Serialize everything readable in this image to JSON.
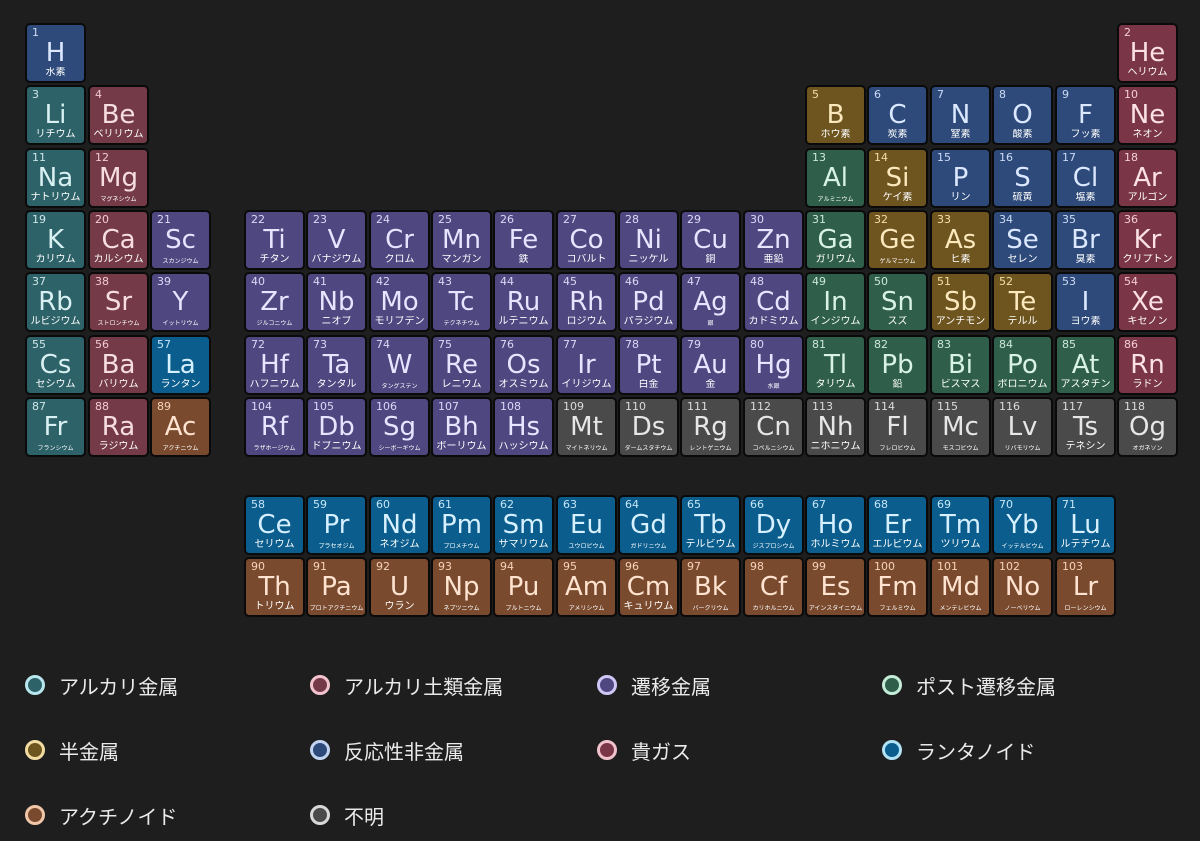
{
  "colors": {
    "alkali": {
      "bg": "#2d6269",
      "sym": "#d8f0f2",
      "num": "#cfe6e8",
      "dot": "#b8e6ee"
    },
    "alkaline": {
      "bg": "#743a48",
      "sym": "#f6dde2",
      "num": "#f2cad2",
      "dot": "#f3c4cf"
    },
    "transition": {
      "bg": "#4e4780",
      "sym": "#e8e4ff",
      "num": "#ddd8f6",
      "dot": "#cfc6f6"
    },
    "post": {
      "bg": "#2f5f4b",
      "sym": "#d8f2e6",
      "num": "#cce8da",
      "dot": "#c4ecd8"
    },
    "metalloid": {
      "bg": "#6e5520",
      "sym": "#fbe9bd",
      "num": "#f6dfa6",
      "dot": "#f2dca2"
    },
    "nonmetal": {
      "bg": "#2e4a7a",
      "sym": "#dbe8ff",
      "num": "#cddcf6",
      "dot": "#c2d4f2"
    },
    "noble": {
      "bg": "#7a3646",
      "sym": "#fbe0e6",
      "num": "#f4cdd6",
      "dot": "#f0c2cc"
    },
    "lanth": {
      "bg": "#0a5d8c",
      "sym": "#d6f0ff",
      "num": "#c6e6f8",
      "dot": "#b2e2f6"
    },
    "actin": {
      "bg": "#7a4a2e",
      "sym": "#fde3d0",
      "num": "#f6d3bb",
      "dot": "#f0c6a8"
    },
    "unknown": {
      "bg": "#4a4a4a",
      "sym": "#e6e6e6",
      "num": "#dcdcdc",
      "dot": "#d8d8d8"
    }
  },
  "elements": [
    {
      "n": "1",
      "s": "H",
      "jp": "水素",
      "c": "nonmetal",
      "col": 1,
      "row": 1
    },
    {
      "n": "2",
      "s": "He",
      "jp": "ヘリウム",
      "c": "noble",
      "col": 18,
      "row": 1
    },
    {
      "n": "3",
      "s": "Li",
      "jp": "リチウム",
      "c": "alkali",
      "col": 1,
      "row": 2
    },
    {
      "n": "4",
      "s": "Be",
      "jp": "ベリリウム",
      "c": "alkaline",
      "col": 2,
      "row": 2
    },
    {
      "n": "5",
      "s": "B",
      "jp": "ホウ素",
      "c": "metalloid",
      "col": 13,
      "row": 2
    },
    {
      "n": "6",
      "s": "C",
      "jp": "炭素",
      "c": "nonmetal",
      "col": 14,
      "row": 2
    },
    {
      "n": "7",
      "s": "N",
      "jp": "窒素",
      "c": "nonmetal",
      "col": 15,
      "row": 2
    },
    {
      "n": "8",
      "s": "O",
      "jp": "酸素",
      "c": "nonmetal",
      "col": 16,
      "row": 2
    },
    {
      "n": "9",
      "s": "F",
      "jp": "フッ素",
      "c": "nonmetal",
      "col": 17,
      "row": 2
    },
    {
      "n": "10",
      "s": "Ne",
      "jp": "ネオン",
      "c": "noble",
      "col": 18,
      "row": 2
    },
    {
      "n": "11",
      "s": "Na",
      "jp": "ナトリウム",
      "c": "alkali",
      "col": 1,
      "row": 3
    },
    {
      "n": "12",
      "s": "Mg",
      "jp": "マグネシウム",
      "c": "alkaline",
      "col": 2,
      "row": 3,
      "sz": "xs"
    },
    {
      "n": "13",
      "s": "Al",
      "jp": "アルミニウム",
      "c": "post",
      "col": 13,
      "row": 3,
      "sz": "xs"
    },
    {
      "n": "14",
      "s": "Si",
      "jp": "ケイ素",
      "c": "metalloid",
      "col": 14,
      "row": 3
    },
    {
      "n": "15",
      "s": "P",
      "jp": "リン",
      "c": "nonmetal",
      "col": 15,
      "row": 3
    },
    {
      "n": "16",
      "s": "S",
      "jp": "硫黄",
      "c": "nonmetal",
      "col": 16,
      "row": 3
    },
    {
      "n": "17",
      "s": "Cl",
      "jp": "塩素",
      "c": "nonmetal",
      "col": 17,
      "row": 3
    },
    {
      "n": "18",
      "s": "Ar",
      "jp": "アルゴン",
      "c": "noble",
      "col": 18,
      "row": 3
    },
    {
      "n": "19",
      "s": "K",
      "jp": "カリウム",
      "c": "alkali",
      "col": 1,
      "row": 4
    },
    {
      "n": "20",
      "s": "Ca",
      "jp": "カルシウム",
      "c": "alkaline",
      "col": 2,
      "row": 4
    },
    {
      "n": "21",
      "s": "Sc",
      "jp": "スカンジウム",
      "c": "transition",
      "col": 3,
      "row": 4,
      "sz": "xs"
    },
    {
      "n": "22",
      "s": "Ti",
      "jp": "チタン",
      "c": "transition",
      "col": 4,
      "row": 4
    },
    {
      "n": "23",
      "s": "V",
      "jp": "バナジウム",
      "c": "transition",
      "col": 5,
      "row": 4
    },
    {
      "n": "24",
      "s": "Cr",
      "jp": "クロム",
      "c": "transition",
      "col": 6,
      "row": 4
    },
    {
      "n": "25",
      "s": "Mn",
      "jp": "マンガン",
      "c": "transition",
      "col": 7,
      "row": 4
    },
    {
      "n": "26",
      "s": "Fe",
      "jp": "鉄",
      "c": "transition",
      "col": 8,
      "row": 4
    },
    {
      "n": "27",
      "s": "Co",
      "jp": "コバルト",
      "c": "transition",
      "col": 9,
      "row": 4
    },
    {
      "n": "28",
      "s": "Ni",
      "jp": "ニッケル",
      "c": "transition",
      "col": 10,
      "row": 4
    },
    {
      "n": "29",
      "s": "Cu",
      "jp": "銅",
      "c": "transition",
      "col": 11,
      "row": 4
    },
    {
      "n": "30",
      "s": "Zn",
      "jp": "亜鉛",
      "c": "transition",
      "col": 12,
      "row": 4
    },
    {
      "n": "31",
      "s": "Ga",
      "jp": "ガリウム",
      "c": "post",
      "col": 13,
      "row": 4
    },
    {
      "n": "32",
      "s": "Ge",
      "jp": "ゲルマニウム",
      "c": "metalloid",
      "col": 14,
      "row": 4,
      "sz": "xs"
    },
    {
      "n": "33",
      "s": "As",
      "jp": "ヒ素",
      "c": "metalloid",
      "col": 15,
      "row": 4
    },
    {
      "n": "34",
      "s": "Se",
      "jp": "セレン",
      "c": "nonmetal",
      "col": 16,
      "row": 4
    },
    {
      "n": "35",
      "s": "Br",
      "jp": "臭素",
      "c": "nonmetal",
      "col": 17,
      "row": 4
    },
    {
      "n": "36",
      "s": "Kr",
      "jp": "クリプトン",
      "c": "noble",
      "col": 18,
      "row": 4
    },
    {
      "n": "37",
      "s": "Rb",
      "jp": "ルビジウム",
      "c": "alkali",
      "col": 1,
      "row": 5
    },
    {
      "n": "38",
      "s": "Sr",
      "jp": "ストロンチウム",
      "c": "alkaline",
      "col": 2,
      "row": 5,
      "sz": "xs"
    },
    {
      "n": "39",
      "s": "Y",
      "jp": "イットリウム",
      "c": "transition",
      "col": 3,
      "row": 5,
      "sz": "xs"
    },
    {
      "n": "40",
      "s": "Zr",
      "jp": "ジルコニウム",
      "c": "transition",
      "col": 4,
      "row": 5,
      "sz": "xs"
    },
    {
      "n": "41",
      "s": "Nb",
      "jp": "ニオブ",
      "c": "transition",
      "col": 5,
      "row": 5
    },
    {
      "n": "42",
      "s": "Mo",
      "jp": "モリブデン",
      "c": "transition",
      "col": 6,
      "row": 5
    },
    {
      "n": "43",
      "s": "Tc",
      "jp": "テクネチウム",
      "c": "transition",
      "col": 7,
      "row": 5,
      "sz": "xs"
    },
    {
      "n": "44",
      "s": "Ru",
      "jp": "ルテニウム",
      "c": "transition",
      "col": 8,
      "row": 5
    },
    {
      "n": "45",
      "s": "Rh",
      "jp": "ロジウム",
      "c": "transition",
      "col": 9,
      "row": 5
    },
    {
      "n": "46",
      "s": "Pd",
      "jp": "パラジウム",
      "c": "transition",
      "col": 10,
      "row": 5
    },
    {
      "n": "47",
      "s": "Ag",
      "jp": "銀",
      "c": "transition",
      "col": 11,
      "row": 5,
      "sz": "xs"
    },
    {
      "n": "48",
      "s": "Cd",
      "jp": "カドミウム",
      "c": "transition",
      "col": 12,
      "row": 5
    },
    {
      "n": "49",
      "s": "In",
      "jp": "インジウム",
      "c": "post",
      "col": 13,
      "row": 5
    },
    {
      "n": "50",
      "s": "Sn",
      "jp": "スズ",
      "c": "post",
      "col": 14,
      "row": 5
    },
    {
      "n": "51",
      "s": "Sb",
      "jp": "アンチモン",
      "c": "metalloid",
      "col": 15,
      "row": 5
    },
    {
      "n": "52",
      "s": "Te",
      "jp": "テルル",
      "c": "metalloid",
      "col": 16,
      "row": 5
    },
    {
      "n": "53",
      "s": "I",
      "jp": "ヨウ素",
      "c": "nonmetal",
      "col": 17,
      "row": 5
    },
    {
      "n": "54",
      "s": "Xe",
      "jp": "キセノン",
      "c": "noble",
      "col": 18,
      "row": 5
    },
    {
      "n": "55",
      "s": "Cs",
      "jp": "セシウム",
      "c": "alkali",
      "col": 1,
      "row": 6
    },
    {
      "n": "56",
      "s": "Ba",
      "jp": "バリウム",
      "c": "alkaline",
      "col": 2,
      "row": 6
    },
    {
      "n": "57",
      "s": "La",
      "jp": "ランタン",
      "c": "lanth",
      "col": 3,
      "row": 6
    },
    {
      "n": "72",
      "s": "Hf",
      "jp": "ハフニウム",
      "c": "transition",
      "col": 4,
      "row": 6
    },
    {
      "n": "73",
      "s": "Ta",
      "jp": "タンタル",
      "c": "transition",
      "col": 5,
      "row": 6
    },
    {
      "n": "74",
      "s": "W",
      "jp": "タングステン",
      "c": "transition",
      "col": 6,
      "row": 6,
      "sz": "xs"
    },
    {
      "n": "75",
      "s": "Re",
      "jp": "レニウム",
      "c": "transition",
      "col": 7,
      "row": 6
    },
    {
      "n": "76",
      "s": "Os",
      "jp": "オスミウム",
      "c": "transition",
      "col": 8,
      "row": 6
    },
    {
      "n": "77",
      "s": "Ir",
      "jp": "イリジウム",
      "c": "transition",
      "col": 9,
      "row": 6
    },
    {
      "n": "78",
      "s": "Pt",
      "jp": "白金",
      "c": "transition",
      "col": 10,
      "row": 6
    },
    {
      "n": "79",
      "s": "Au",
      "jp": "金",
      "c": "transition",
      "col": 11,
      "row": 6
    },
    {
      "n": "80",
      "s": "Hg",
      "jp": "水銀",
      "c": "transition",
      "col": 12,
      "row": 6,
      "sz": "xs"
    },
    {
      "n": "81",
      "s": "Tl",
      "jp": "タリウム",
      "c": "post",
      "col": 13,
      "row": 6
    },
    {
      "n": "82",
      "s": "Pb",
      "jp": "鉛",
      "c": "post",
      "col": 14,
      "row": 6
    },
    {
      "n": "83",
      "s": "Bi",
      "jp": "ビスマス",
      "c": "post",
      "col": 15,
      "row": 6
    },
    {
      "n": "84",
      "s": "Po",
      "jp": "ポロニウム",
      "c": "post",
      "col": 16,
      "row": 6
    },
    {
      "n": "85",
      "s": "At",
      "jp": "アスタチン",
      "c": "post",
      "col": 17,
      "row": 6
    },
    {
      "n": "86",
      "s": "Rn",
      "jp": "ラドン",
      "c": "noble",
      "col": 18,
      "row": 6
    },
    {
      "n": "87",
      "s": "Fr",
      "jp": "フランシウム",
      "c": "alkali",
      "col": 1,
      "row": 7,
      "sz": "xs"
    },
    {
      "n": "88",
      "s": "Ra",
      "jp": "ラジウム",
      "c": "alkaline",
      "col": 2,
      "row": 7
    },
    {
      "n": "89",
      "s": "Ac",
      "jp": "アクチニウム",
      "c": "actin",
      "col": 3,
      "row": 7,
      "sz": "xs"
    },
    {
      "n": "104",
      "s": "Rf",
      "jp": "ラザホージウム",
      "c": "transition",
      "col": 4,
      "row": 7,
      "sz": "xs"
    },
    {
      "n": "105",
      "s": "Db",
      "jp": "ドブニウム",
      "c": "transition",
      "col": 5,
      "row": 7
    },
    {
      "n": "106",
      "s": "Sg",
      "jp": "シーボーギウム",
      "c": "transition",
      "col": 6,
      "row": 7,
      "sz": "xs"
    },
    {
      "n": "107",
      "s": "Bh",
      "jp": "ボーリウム",
      "c": "transition",
      "col": 7,
      "row": 7
    },
    {
      "n": "108",
      "s": "Hs",
      "jp": "ハッシウム",
      "c": "transition",
      "col": 8,
      "row": 7
    },
    {
      "n": "109",
      "s": "Mt",
      "jp": "マイトネリウム",
      "c": "unknown",
      "col": 9,
      "row": 7,
      "sz": "xs"
    },
    {
      "n": "110",
      "s": "Ds",
      "jp": "ダームスタチウム",
      "c": "unknown",
      "col": 10,
      "row": 7,
      "sz": "xs"
    },
    {
      "n": "111",
      "s": "Rg",
      "jp": "レントゲニウム",
      "c": "unknown",
      "col": 11,
      "row": 7,
      "sz": "xs"
    },
    {
      "n": "112",
      "s": "Cn",
      "jp": "コペルニシウム",
      "c": "unknown",
      "col": 12,
      "row": 7,
      "sz": "xs"
    },
    {
      "n": "113",
      "s": "Nh",
      "jp": "ニホニウム",
      "c": "unknown",
      "col": 13,
      "row": 7
    },
    {
      "n": "114",
      "s": "Fl",
      "jp": "フレロビウム",
      "c": "unknown",
      "col": 14,
      "row": 7,
      "sz": "xs"
    },
    {
      "n": "115",
      "s": "Mc",
      "jp": "モスコビウム",
      "c": "unknown",
      "col": 15,
      "row": 7,
      "sz": "xs"
    },
    {
      "n": "116",
      "s": "Lv",
      "jp": "リバモリウム",
      "c": "unknown",
      "col": 16,
      "row": 7,
      "sz": "xs"
    },
    {
      "n": "117",
      "s": "Ts",
      "jp": "テネシン",
      "c": "unknown",
      "col": 17,
      "row": 7
    },
    {
      "n": "118",
      "s": "Og",
      "jp": "オガネソン",
      "c": "unknown",
      "col": 18,
      "row": 7,
      "sz": "xs"
    },
    {
      "n": "58",
      "s": "Ce",
      "jp": "セリウム",
      "c": "lanth",
      "col": 4,
      "row": 9
    },
    {
      "n": "59",
      "s": "Pr",
      "jp": "プラセオジム",
      "c": "lanth",
      "col": 5,
      "row": 9,
      "sz": "xs"
    },
    {
      "n": "60",
      "s": "Nd",
      "jp": "ネオジム",
      "c": "lanth",
      "col": 6,
      "row": 9
    },
    {
      "n": "61",
      "s": "Pm",
      "jp": "プロメチウム",
      "c": "lanth",
      "col": 7,
      "row": 9,
      "sz": "xs"
    },
    {
      "n": "62",
      "s": "Sm",
      "jp": "サマリウム",
      "c": "lanth",
      "col": 8,
      "row": 9
    },
    {
      "n": "63",
      "s": "Eu",
      "jp": "ユウロピウム",
      "c": "lanth",
      "col": 9,
      "row": 9,
      "sz": "xs"
    },
    {
      "n": "64",
      "s": "Gd",
      "jp": "ガドリニウム",
      "c": "lanth",
      "col": 10,
      "row": 9,
      "sz": "xs"
    },
    {
      "n": "65",
      "s": "Tb",
      "jp": "テルビウム",
      "c": "lanth",
      "col": 11,
      "row": 9
    },
    {
      "n": "66",
      "s": "Dy",
      "jp": "ジスプロシウム",
      "c": "lanth",
      "col": 12,
      "row": 9,
      "sz": "xs"
    },
    {
      "n": "67",
      "s": "Ho",
      "jp": "ホルミウム",
      "c": "lanth",
      "col": 13,
      "row": 9
    },
    {
      "n": "68",
      "s": "Er",
      "jp": "エルビウム",
      "c": "lanth",
      "col": 14,
      "row": 9
    },
    {
      "n": "69",
      "s": "Tm",
      "jp": "ツリウム",
      "c": "lanth",
      "col": 15,
      "row": 9
    },
    {
      "n": "70",
      "s": "Yb",
      "jp": "イッテルビウム",
      "c": "lanth",
      "col": 16,
      "row": 9,
      "sz": "xs"
    },
    {
      "n": "71",
      "s": "Lu",
      "jp": "ルテチウム",
      "c": "lanth",
      "col": 17,
      "row": 9
    },
    {
      "n": "90",
      "s": "Th",
      "jp": "トリウム",
      "c": "actin",
      "col": 4,
      "row": 10
    },
    {
      "n": "91",
      "s": "Pa",
      "jp": "プロトアクチニウム",
      "c": "actin",
      "col": 5,
      "row": 10,
      "sz": "xs"
    },
    {
      "n": "92",
      "s": "U",
      "jp": "ウラン",
      "c": "actin",
      "col": 6,
      "row": 10
    },
    {
      "n": "93",
      "s": "Np",
      "jp": "ネプツニウム",
      "c": "actin",
      "col": 7,
      "row": 10,
      "sz": "xs"
    },
    {
      "n": "94",
      "s": "Pu",
      "jp": "プルトニウム",
      "c": "actin",
      "col": 8,
      "row": 10,
      "sz": "xs"
    },
    {
      "n": "95",
      "s": "Am",
      "jp": "アメリシウム",
      "c": "actin",
      "col": 9,
      "row": 10,
      "sz": "xs"
    },
    {
      "n": "96",
      "s": "Cm",
      "jp": "キュリウム",
      "c": "actin",
      "col": 10,
      "row": 10
    },
    {
      "n": "97",
      "s": "Bk",
      "jp": "バークリウム",
      "c": "actin",
      "col": 11,
      "row": 10,
      "sz": "xs"
    },
    {
      "n": "98",
      "s": "Cf",
      "jp": "カリホルニウム",
      "c": "actin",
      "col": 12,
      "row": 10,
      "sz": "xs"
    },
    {
      "n": "99",
      "s": "Es",
      "jp": "アインスタイニウム",
      "c": "actin",
      "col": 13,
      "row": 10,
      "sz": "xs"
    },
    {
      "n": "100",
      "s": "Fm",
      "jp": "フェルミウム",
      "c": "actin",
      "col": 14,
      "row": 10,
      "sz": "xs"
    },
    {
      "n": "101",
      "s": "Md",
      "jp": "メンデレビウム",
      "c": "actin",
      "col": 15,
      "row": 10,
      "sz": "xs"
    },
    {
      "n": "102",
      "s": "No",
      "jp": "ノーベリウム",
      "c": "actin",
      "col": 16,
      "row": 10,
      "sz": "xs"
    },
    {
      "n": "103",
      "s": "Lr",
      "jp": "ローレンシウム",
      "c": "actin",
      "col": 17,
      "row": 10,
      "sz": "xs"
    }
  ],
  "legend": [
    {
      "key": "alkali",
      "label": "アルカリ金属"
    },
    {
      "key": "alkaline",
      "label": "アルカリ土類金属"
    },
    {
      "key": "transition",
      "label": "遷移金属"
    },
    {
      "key": "post",
      "label": "ポスト遷移金属"
    },
    {
      "key": "metalloid",
      "label": "半金属"
    },
    {
      "key": "nonmetal",
      "label": "反応性非金属"
    },
    {
      "key": "noble",
      "label": "貴ガス"
    },
    {
      "key": "lanth",
      "label": "ランタノイド"
    },
    {
      "key": "actin",
      "label": "アクチノイド"
    },
    {
      "key": "unknown",
      "label": "不明"
    }
  ]
}
